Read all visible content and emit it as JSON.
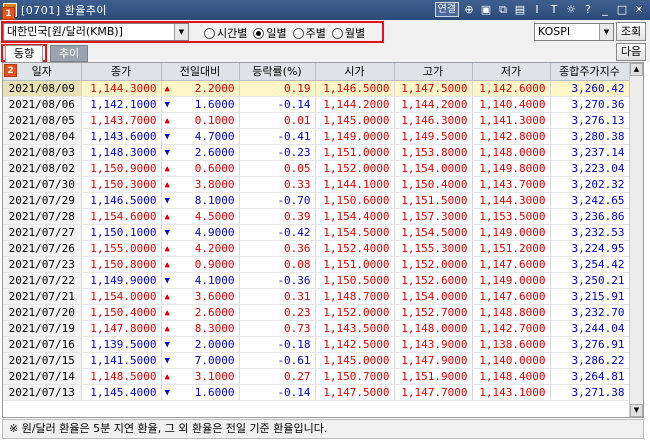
{
  "window": {
    "title": "[0701] 환율추이",
    "controls": [
      "연결",
      "⊕",
      "▣",
      "⧉",
      "▤",
      "Ⅰ",
      "T",
      "☼",
      "?",
      "_",
      "□",
      "✕"
    ]
  },
  "toolbar": {
    "country_select": "대한민국[원/달러(KMB)]",
    "period_options": [
      "시간별",
      "일별",
      "주별",
      "월별"
    ],
    "period_selected": "일별",
    "index_select": "KOSPI",
    "query_button": "조회",
    "next_button": "다음"
  },
  "markers": {
    "m1": "1",
    "m2": "2"
  },
  "tabs": [
    {
      "label": "동향",
      "active": true
    },
    {
      "label": "추이",
      "active": false
    }
  ],
  "table": {
    "headers": [
      "일자",
      "종가",
      "전일대비",
      "등락률(%)",
      "시가",
      "고가",
      "저가",
      "종합주가지수"
    ],
    "rows": [
      {
        "date": "2021/08/09",
        "close": "1,144.3000",
        "dir": "up",
        "chg": "2.2000",
        "rate": "0.19",
        "open": "1,146.5000",
        "high": "1,147.5000",
        "low": "1,142.6000",
        "index": "3,260.42"
      },
      {
        "date": "2021/08/06",
        "close": "1,142.1000",
        "dir": "down",
        "chg": "1.6000",
        "rate": "-0.14",
        "open": "1,144.2000",
        "high": "1,144.2000",
        "low": "1,140.4000",
        "index": "3,270.36"
      },
      {
        "date": "2021/08/05",
        "close": "1,143.7000",
        "dir": "up",
        "chg": "0.1000",
        "rate": "0.01",
        "open": "1,145.0000",
        "high": "1,146.3000",
        "low": "1,141.3000",
        "index": "3,276.13"
      },
      {
        "date": "2021/08/04",
        "close": "1,143.6000",
        "dir": "down",
        "chg": "4.7000",
        "rate": "-0.41",
        "open": "1,149.0000",
        "high": "1,149.5000",
        "low": "1,142.8000",
        "index": "3,280.38"
      },
      {
        "date": "2021/08/03",
        "close": "1,148.3000",
        "dir": "down",
        "chg": "2.6000",
        "rate": "-0.23",
        "open": "1,151.0000",
        "high": "1,153.8000",
        "low": "1,148.0000",
        "index": "3,237.14"
      },
      {
        "date": "2021/08/02",
        "close": "1,150.9000",
        "dir": "up",
        "chg": "0.6000",
        "rate": "0.05",
        "open": "1,152.0000",
        "high": "1,154.0000",
        "low": "1,149.8000",
        "index": "3,223.04"
      },
      {
        "date": "2021/07/30",
        "close": "1,150.3000",
        "dir": "up",
        "chg": "3.8000",
        "rate": "0.33",
        "open": "1,144.1000",
        "high": "1,150.4000",
        "low": "1,143.7000",
        "index": "3,202.32"
      },
      {
        "date": "2021/07/29",
        "close": "1,146.5000",
        "dir": "down",
        "chg": "8.1000",
        "rate": "-0.70",
        "open": "1,150.6000",
        "high": "1,151.5000",
        "low": "1,144.3000",
        "index": "3,242.65"
      },
      {
        "date": "2021/07/28",
        "close": "1,154.6000",
        "dir": "up",
        "chg": "4.5000",
        "rate": "0.39",
        "open": "1,154.4000",
        "high": "1,157.3000",
        "low": "1,153.5000",
        "index": "3,236.86"
      },
      {
        "date": "2021/07/27",
        "close": "1,150.1000",
        "dir": "down",
        "chg": "4.9000",
        "rate": "-0.42",
        "open": "1,154.5000",
        "high": "1,154.5000",
        "low": "1,149.0000",
        "index": "3,232.53"
      },
      {
        "date": "2021/07/26",
        "close": "1,155.0000",
        "dir": "up",
        "chg": "4.2000",
        "rate": "0.36",
        "open": "1,152.4000",
        "high": "1,155.3000",
        "low": "1,151.2000",
        "index": "3,224.95"
      },
      {
        "date": "2021/07/23",
        "close": "1,150.8000",
        "dir": "up",
        "chg": "0.9000",
        "rate": "0.08",
        "open": "1,151.0000",
        "high": "1,152.0000",
        "low": "1,147.6000",
        "index": "3,254.42"
      },
      {
        "date": "2021/07/22",
        "close": "1,149.9000",
        "dir": "down",
        "chg": "4.1000",
        "rate": "-0.36",
        "open": "1,150.5000",
        "high": "1,152.6000",
        "low": "1,149.0000",
        "index": "3,250.21"
      },
      {
        "date": "2021/07/21",
        "close": "1,154.0000",
        "dir": "up",
        "chg": "3.6000",
        "rate": "0.31",
        "open": "1,148.7000",
        "high": "1,154.0000",
        "low": "1,147.6000",
        "index": "3,215.91"
      },
      {
        "date": "2021/07/20",
        "close": "1,150.4000",
        "dir": "up",
        "chg": "2.6000",
        "rate": "0.23",
        "open": "1,152.0000",
        "high": "1,152.7000",
        "low": "1,148.8000",
        "index": "3,232.70"
      },
      {
        "date": "2021/07/19",
        "close": "1,147.8000",
        "dir": "up",
        "chg": "8.3000",
        "rate": "0.73",
        "open": "1,143.5000",
        "high": "1,148.0000",
        "low": "1,142.7000",
        "index": "3,244.04"
      },
      {
        "date": "2021/07/16",
        "close": "1,139.5000",
        "dir": "down",
        "chg": "2.0000",
        "rate": "-0.18",
        "open": "1,142.5000",
        "high": "1,143.9000",
        "low": "1,138.6000",
        "index": "3,276.91"
      },
      {
        "date": "2021/07/15",
        "close": "1,141.5000",
        "dir": "down",
        "chg": "7.0000",
        "rate": "-0.61",
        "open": "1,145.0000",
        "high": "1,147.9000",
        "low": "1,140.0000",
        "index": "3,286.22"
      },
      {
        "date": "2021/07/14",
        "close": "1,148.5000",
        "dir": "up",
        "chg": "3.1000",
        "rate": "0.27",
        "open": "1,150.7000",
        "high": "1,151.9000",
        "low": "1,148.4000",
        "index": "3,264.81"
      },
      {
        "date": "2021/07/13",
        "close": "1,145.4000",
        "dir": "down",
        "chg": "1.6000",
        "rate": "-0.14",
        "open": "1,147.5000",
        "high": "1,147.7000",
        "low": "1,143.1000",
        "index": "3,271.38"
      }
    ]
  },
  "footer": {
    "note": "※ 원/달러 환율은 5분 지연 환율, 그 외 환율은 전일 기준 환율입니다."
  },
  "colors": {
    "up": "#e00000",
    "down": "#0000d0",
    "selected_row": "#fff6c8",
    "marker": "#e8501c",
    "highlight_box": "#e0151a"
  }
}
